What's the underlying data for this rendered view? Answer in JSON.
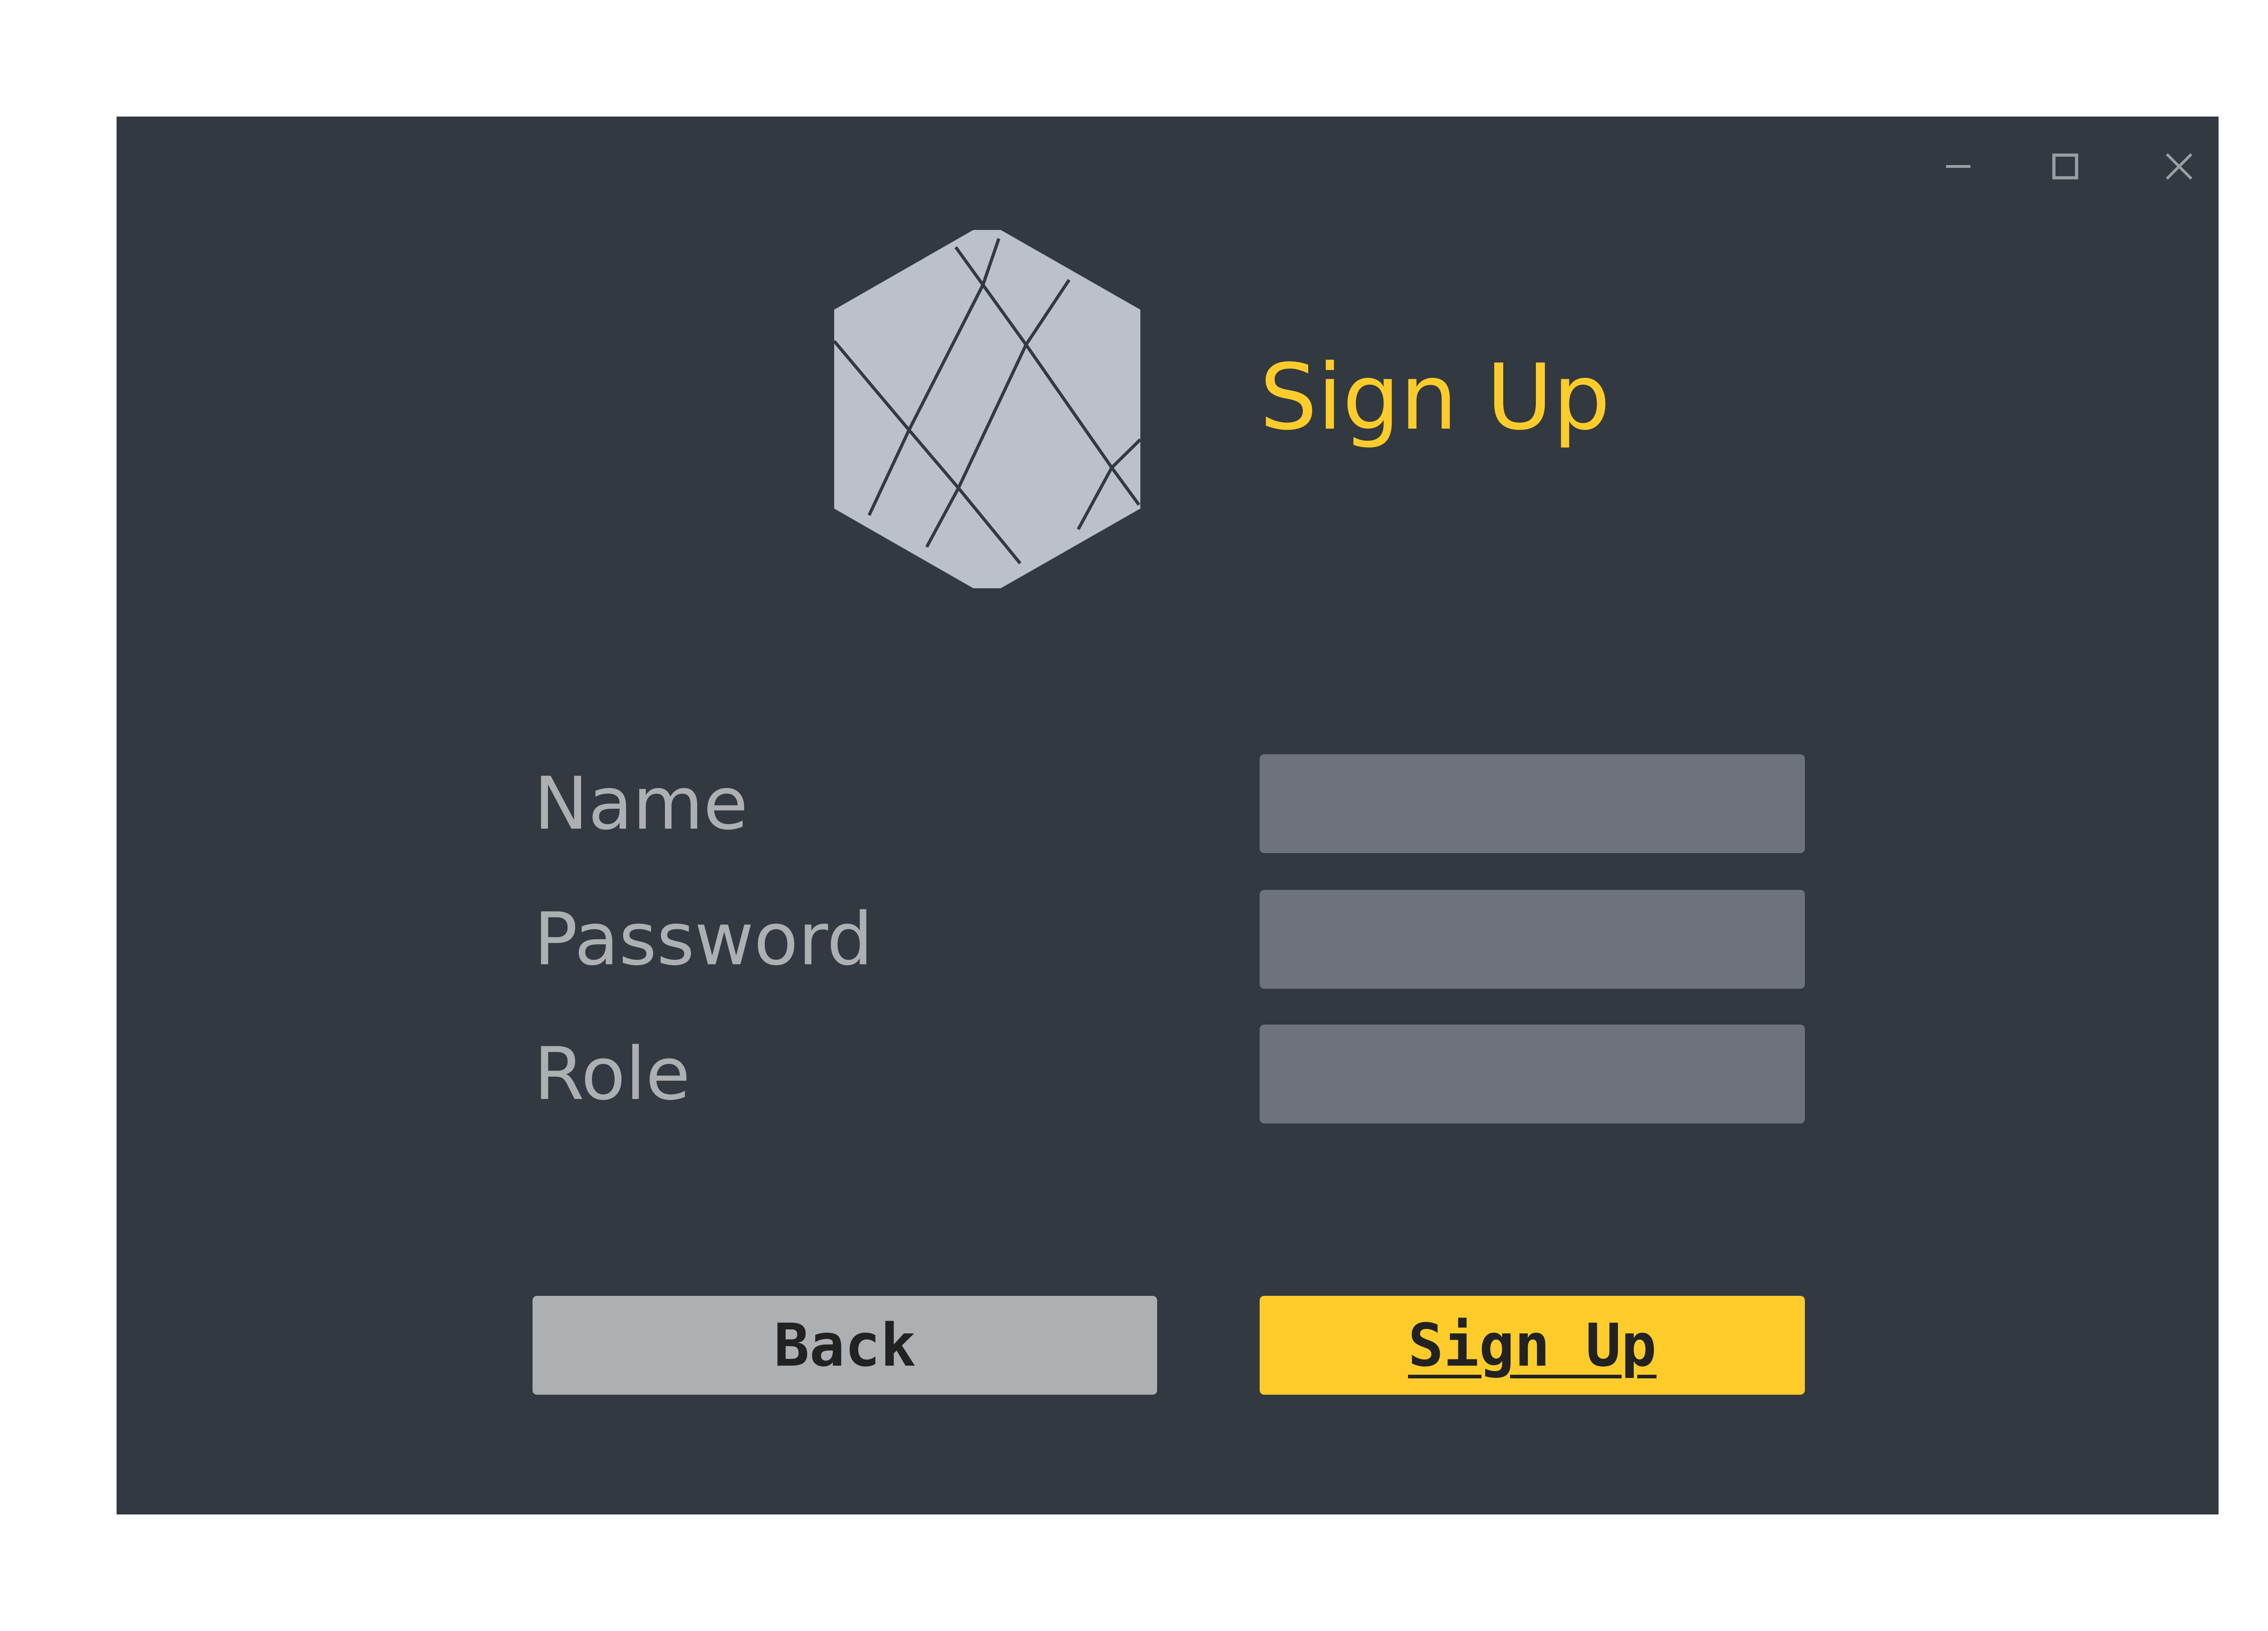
{
  "window": {
    "controls": {
      "minimize_icon": "minimize-icon",
      "maximize_icon": "maximize-icon",
      "close_icon": "close-icon"
    }
  },
  "header": {
    "logo_icon": "hexagon-logo-icon",
    "title": "Sign Up"
  },
  "form": {
    "fields": [
      {
        "label": "Name",
        "value": "",
        "placeholder": ""
      },
      {
        "label": "Password",
        "value": "",
        "placeholder": ""
      },
      {
        "label": "Role",
        "value": "",
        "placeholder": ""
      }
    ]
  },
  "actions": {
    "back_label": "Back",
    "signup_label": "Sign Up"
  },
  "colors": {
    "background": "#323940",
    "accent": "#fdcc2b",
    "field": "#6d727b",
    "label": "#adb0b3",
    "logo": "#bcc0c8",
    "secondary_button": "#adb0b3"
  }
}
